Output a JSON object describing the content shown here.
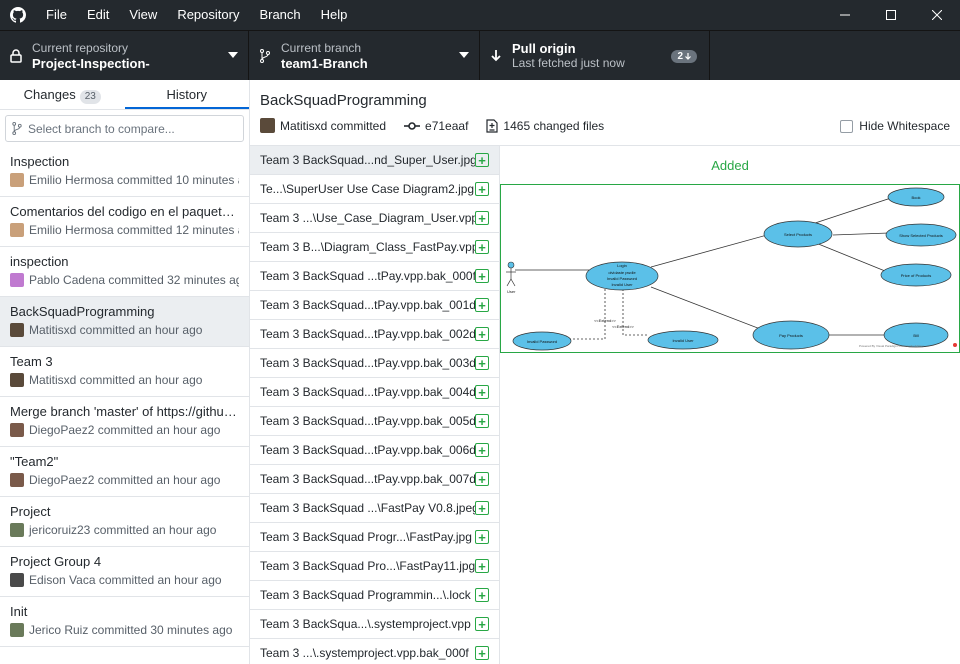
{
  "menu": [
    "File",
    "Edit",
    "View",
    "Repository",
    "Branch",
    "Help"
  ],
  "toolbar": {
    "repo_label": "Current repository",
    "repo_value": "Project-Inspection-",
    "branch_label": "Current branch",
    "branch_value": "team1-Branch",
    "pull_title": "Pull origin",
    "pull_sub": "Last fetched just now",
    "pull_count": "2"
  },
  "tabs": {
    "changes": "Changes",
    "changes_count": "23",
    "history": "History"
  },
  "branch_compare": {
    "placeholder": "Select branch to compare..."
  },
  "commits": [
    {
      "title": "Inspection",
      "meta": "Emilio Hermosa committed 10 minutes a...",
      "avatar_color": "#c9a07a"
    },
    {
      "title": "Comentarios del codigo en el paquete c...",
      "meta": "Emilio Hermosa committed 12 minutes a...",
      "avatar_color": "#c9a07a"
    },
    {
      "title": "inspection",
      "meta": "Pablo Cadena committed 32 minutes ago",
      "avatar_color": "#c07ad0"
    },
    {
      "title": "BackSquadProgramming",
      "meta": "Matitisxd committed an hour ago",
      "avatar_color": "#5a4a3a"
    },
    {
      "title": "Team 3",
      "meta": "Matitisxd committed an hour ago",
      "avatar_color": "#5a4a3a"
    },
    {
      "title": "Merge branch 'master' of https://github...",
      "meta": "DiegoPaez2 committed an hour ago",
      "avatar_color": "#7a5a4a"
    },
    {
      "title": "\"Team2\"",
      "meta": "DiegoPaez2 committed an hour ago",
      "avatar_color": "#7a5a4a"
    },
    {
      "title": "Project",
      "meta": "jericoruiz23 committed an hour ago",
      "avatar_color": "#6a7a5a"
    },
    {
      "title": "Project Group 4",
      "meta": "Edison Vaca committed an hour ago",
      "avatar_color": "#4a4a4a"
    },
    {
      "title": "Init",
      "meta": "Jerico Ruiz committed 30 minutes ago",
      "avatar_color": "#6a7a5a"
    }
  ],
  "commit_header": {
    "title": "BackSquadProgramming",
    "author": "Matitisxd committed",
    "sha": "e71eaaf",
    "changed": "1465 changed files",
    "hide_whitespace": "Hide Whitespace"
  },
  "files": [
    "Team 3 BackSquad...nd_Super_User.jpg",
    "Te...\\SuperUser Use Case Diagram2.jpg",
    "Team 3 ...\\Use_Case_Diagram_User.vpp",
    "Team 3 B...\\Diagram_Class_FastPay.vpp",
    "Team 3 BackSquad ...tPay.vpp.bak_000f",
    "Team 3 BackSquad...tPay.vpp.bak_001d",
    "Team 3 BackSquad...tPay.vpp.bak_002d",
    "Team 3 BackSquad...tPay.vpp.bak_003d",
    "Team 3 BackSquad...tPay.vpp.bak_004d",
    "Team 3 BackSquad...tPay.vpp.bak_005d",
    "Team 3 BackSquad...tPay.vpp.bak_006d",
    "Team 3 BackSquad...tPay.vpp.bak_007d",
    "Team 3 BackSquad ...\\FastPay V0.8.jpeg",
    "Team 3 BackSquad Progr...\\FastPay.jpg",
    "Team 3 BackSquad Pro...\\FastPay11.jpg",
    "Team 3 BackSquad Programmin...\\.lock",
    "Team 3 BackSqua...\\.systemproject.vpp",
    "Team 3 ...\\.systemproject.vpp.bak_000f"
  ],
  "diff": {
    "status": "Added",
    "diagram": {
      "actor": "User",
      "login": [
        "Login",
        "olvidaste pwdle",
        "Invalid Password",
        "Invalid User"
      ],
      "select_products": "Select Products",
      "book": "Book",
      "show_selected": "Show Selected Products",
      "price": "Price of Products",
      "pay": "Pay Products",
      "bill": "Bill",
      "invalid_password": "Invalid Password",
      "invalid_user": "Invalid User",
      "extend1": "<<Extend>>",
      "extend2": "<<Extend>>",
      "watermark": "Powered By Visual Paradigm Community Edition"
    }
  },
  "colors": {
    "accent": "#0366d6",
    "added": "#28a745",
    "dark": "#24292e",
    "ellipse": "#5bc0e8"
  }
}
